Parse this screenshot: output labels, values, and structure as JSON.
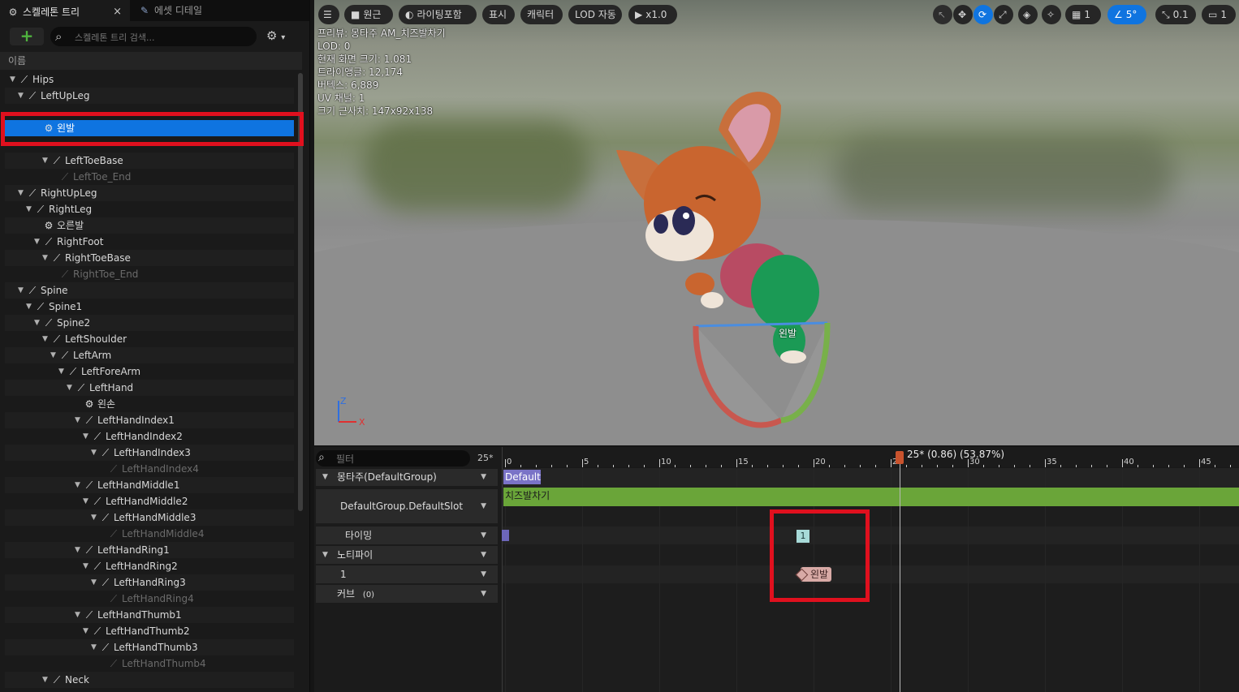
{
  "tabs": [
    {
      "label": "스켈레톤 트리",
      "icon": "skeleton-tree-icon"
    },
    {
      "label": "에셋 디테일",
      "icon": "asset-details-icon"
    }
  ],
  "tab_close": "×",
  "search": {
    "placeholder": "스켈레톤 트리 검색..."
  },
  "column_header": "이름",
  "tree": [
    {
      "label": "Hips",
      "depth": 0,
      "type": "bone"
    },
    {
      "label": "LeftUpLeg",
      "depth": 1,
      "type": "bone"
    },
    {
      "label": "왼발",
      "depth": 3,
      "type": "socket",
      "selected": true
    },
    {
      "label": "LeftToeBase",
      "depth": 4,
      "type": "bone"
    },
    {
      "label": "LeftToe_End",
      "depth": 5,
      "type": "leaf"
    },
    {
      "label": "RightUpLeg",
      "depth": 1,
      "type": "bone"
    },
    {
      "label": "RightLeg",
      "depth": 2,
      "type": "bone"
    },
    {
      "label": "오른발",
      "depth": 3,
      "type": "socket"
    },
    {
      "label": "RightFoot",
      "depth": 3,
      "type": "bone"
    },
    {
      "label": "RightToeBase",
      "depth": 4,
      "type": "bone"
    },
    {
      "label": "RightToe_End",
      "depth": 5,
      "type": "leaf"
    },
    {
      "label": "Spine",
      "depth": 1,
      "type": "bone"
    },
    {
      "label": "Spine1",
      "depth": 2,
      "type": "bone"
    },
    {
      "label": "Spine2",
      "depth": 3,
      "type": "bone"
    },
    {
      "label": "LeftShoulder",
      "depth": 4,
      "type": "bone"
    },
    {
      "label": "LeftArm",
      "depth": 5,
      "type": "bone"
    },
    {
      "label": "LeftForeArm",
      "depth": 6,
      "type": "bone"
    },
    {
      "label": "LeftHand",
      "depth": 7,
      "type": "bone"
    },
    {
      "label": "왼손",
      "depth": 8,
      "type": "socket"
    },
    {
      "label": "LeftHandIndex1",
      "depth": 8,
      "type": "bone"
    },
    {
      "label": "LeftHandIndex2",
      "depth": 9,
      "type": "bone"
    },
    {
      "label": "LeftHandIndex3",
      "depth": 10,
      "type": "bone"
    },
    {
      "label": "LeftHandIndex4",
      "depth": 11,
      "type": "leaf"
    },
    {
      "label": "LeftHandMiddle1",
      "depth": 8,
      "type": "bone"
    },
    {
      "label": "LeftHandMiddle2",
      "depth": 9,
      "type": "bone"
    },
    {
      "label": "LeftHandMiddle3",
      "depth": 10,
      "type": "bone"
    },
    {
      "label": "LeftHandMiddle4",
      "depth": 11,
      "type": "leaf"
    },
    {
      "label": "LeftHandRing1",
      "depth": 8,
      "type": "bone"
    },
    {
      "label": "LeftHandRing2",
      "depth": 9,
      "type": "bone"
    },
    {
      "label": "LeftHandRing3",
      "depth": 10,
      "type": "bone"
    },
    {
      "label": "LeftHandRing4",
      "depth": 11,
      "type": "leaf"
    },
    {
      "label": "LeftHandThumb1",
      "depth": 8,
      "type": "bone"
    },
    {
      "label": "LeftHandThumb2",
      "depth": 9,
      "type": "bone"
    },
    {
      "label": "LeftHandThumb3",
      "depth": 10,
      "type": "bone"
    },
    {
      "label": "LeftHandThumb4",
      "depth": 11,
      "type": "leaf"
    },
    {
      "label": "Neck",
      "depth": 4,
      "type": "bone"
    }
  ],
  "viewport": {
    "toolbar": {
      "menu_icon": "hamburger-menu-icon",
      "view_mode": "원근",
      "lighting": "라이팅포함",
      "show": "표시",
      "character": "캐릭터",
      "lod": "LOD 자동",
      "play_speed": "x1.0",
      "grid_size": "1",
      "rot_snap": "5°",
      "scale_snap": "0.1",
      "camera_speed": "1"
    },
    "stats": [
      "프리뷰: 몽타주 AM_치즈발차기",
      "LOD: 0",
      "현재 화면 크기: 1.081",
      "트라이앵글: 12,174",
      "버텍스: 6,889",
      "UV 채널: 1",
      "크기 근사치: 147x92x138"
    ],
    "socket_label": "왼발",
    "axis": {
      "z": "Z",
      "x": "X"
    }
  },
  "timeline": {
    "filter_placeholder": "필터",
    "total_frames": "25*",
    "tracks": {
      "montage": "몽타주(DefaultGroup)",
      "slot": "DefaultGroup.DefaultSlot",
      "timing": "타이밍",
      "notify": "노티파이",
      "notify_track": "1",
      "curves": "커브",
      "curves_count": "(0)"
    },
    "ruler_labels": [
      "0",
      "5",
      "10",
      "15",
      "20",
      "25",
      "30",
      "35",
      "40",
      "45"
    ],
    "scrubber_label": "25* (0.86) (53.87%)",
    "default_section": "Default",
    "clip_name": "치즈발차기",
    "timing_marker": "1",
    "notify_event": "왼발"
  }
}
